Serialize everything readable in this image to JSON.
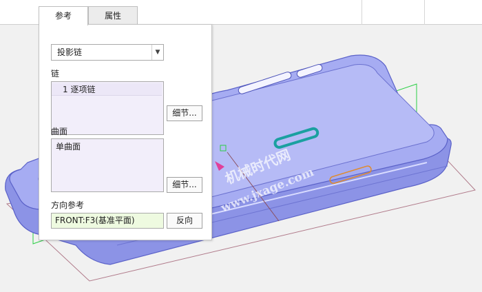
{
  "tabs": [
    {
      "label": "参考",
      "active": true
    },
    {
      "label": "属性",
      "active": false
    }
  ],
  "panel": {
    "type_select": {
      "value": "投影链"
    },
    "chain": {
      "label": "链",
      "items": [
        "1 逐项链"
      ],
      "details_button": "细节..."
    },
    "surface": {
      "label": "曲面",
      "items": [
        "单曲面"
      ],
      "details_button": "细节..."
    },
    "direction": {
      "label": "方向参考",
      "value": "FRONT:F3(基准平面)",
      "flip_button": "反向"
    }
  },
  "watermark": {
    "line1": "机械时代网",
    "line2": "www.jxage.com"
  },
  "colors": {
    "model_fill": "#a6acf2",
    "model_edge": "#5a61c8",
    "datum_green": "#2bcf45",
    "accent_teal": "#1aa0a0",
    "accent_orange": "#e08a2a"
  }
}
